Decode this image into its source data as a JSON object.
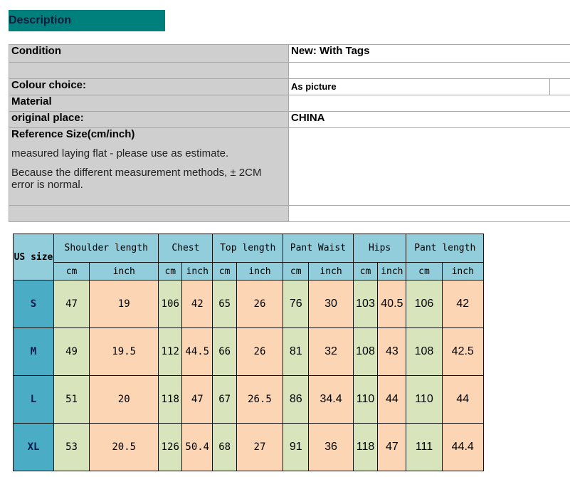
{
  "banner": "Description",
  "info": {
    "condition_label": "Condition",
    "condition_value": "New: With Tags",
    "colour_label": "Colour choice:",
    "colour_value": "As picture",
    "material_label": "Material",
    "material_value": "",
    "place_label": "original place:",
    "place_value": "CHINA",
    "ref_label": "Reference Size(cm/inch)",
    "ref_note1": "measured laying flat - please use as estimate.",
    "ref_note2": "Because the different measurement methods, ± 2CM error is normal."
  },
  "size_table": {
    "size_header": "US size",
    "groups": [
      "Shoulder length",
      "Chest",
      "Top length",
      "Pant Waist",
      "Hips",
      "Pant length"
    ],
    "unit_cm": "cm",
    "unit_inch": "inch",
    "rows": [
      {
        "size": "S",
        "values": [
          "47",
          "19",
          "106",
          "42",
          "65",
          "26",
          "76",
          "30",
          "103",
          "40.5",
          "106",
          "42"
        ]
      },
      {
        "size": "M",
        "values": [
          "49",
          "19.5",
          "112",
          "44.5",
          "66",
          "26",
          "81",
          "32",
          "108",
          "43",
          "108",
          "42.5"
        ]
      },
      {
        "size": "L",
        "values": [
          "51",
          "20",
          "118",
          "47",
          "67",
          "26.5",
          "86",
          "34.4",
          "110",
          "44",
          "110",
          "44"
        ]
      },
      {
        "size": "XL",
        "values": [
          "53",
          "20.5",
          "126",
          "50.4",
          "68",
          "27",
          "91",
          "36",
          "118",
          "47",
          "111",
          "44.4"
        ]
      }
    ],
    "colors": {
      "header": "#92cddc",
      "size_col": "#4bacc6",
      "cm": "#d8e4bc",
      "inch": "#fcd5b4"
    }
  }
}
